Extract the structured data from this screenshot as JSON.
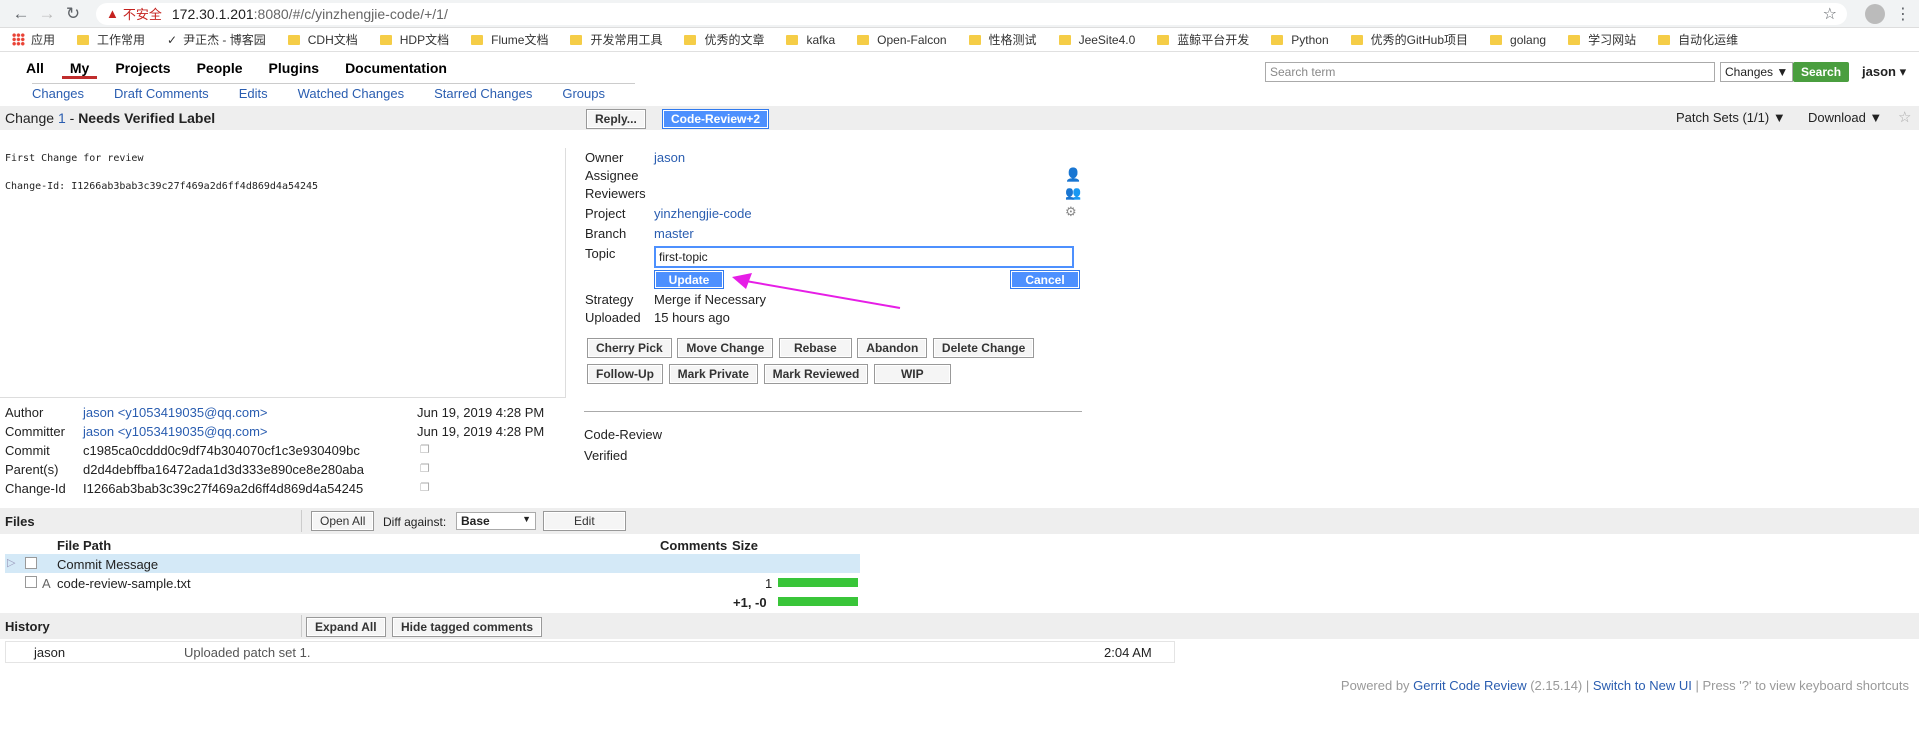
{
  "browser": {
    "url_host": "172.30.1.201",
    "url_rest": ":8080/#/c/yinzhengjie-code/+/1/",
    "insecure_label": "不安全",
    "bookmarks": [
      "应用",
      "工作常用",
      "尹正杰 - 博客园",
      "CDH文档",
      "HDP文档",
      "Flume文档",
      "开发常用工具",
      "优秀的文章",
      "kafka",
      "Open-Falcon",
      "性格测试",
      "JeeSite4.0",
      "蓝鲸平台开发",
      "Python",
      "优秀的GitHub项目",
      "golang",
      "学习网站",
      "自动化运维"
    ]
  },
  "nav": {
    "main": [
      "All",
      "My",
      "Projects",
      "People",
      "Plugins",
      "Documentation"
    ],
    "sub": [
      "Changes",
      "Draft Comments",
      "Edits",
      "Watched Changes",
      "Starred Changes",
      "Groups"
    ],
    "search_placeholder": "Search term",
    "search_scope": "Changes ▼",
    "search_button": "Search",
    "user": "jason ▾"
  },
  "change": {
    "prefix": "Change ",
    "number": "1",
    "dash": " - ",
    "status": "Needs Verified Label",
    "reply": "Reply...",
    "code_review": "Code-Review+2",
    "patch_sets": "Patch Sets (1/1) ▼",
    "download": "Download ▼",
    "commit_message": "First Change for review\n\nChange-Id: I1266ab3bab3c39c27f469a2d6ff4d869d4a54245"
  },
  "info": {
    "owner_label": "Owner",
    "owner": "jason",
    "assignee_label": "Assignee",
    "reviewers_label": "Reviewers",
    "project_label": "Project",
    "project": "yinzhengjie-code",
    "branch_label": "Branch",
    "branch": "master",
    "topic_label": "Topic",
    "topic_value": "first-topic",
    "update": "Update",
    "cancel": "Cancel",
    "strategy_label": "Strategy",
    "strategy": "Merge if Necessary",
    "uploaded_label": "Uploaded",
    "uploaded": "15 hours ago"
  },
  "actions": {
    "row1": [
      "Cherry Pick",
      "Move Change",
      "Rebase",
      "Abandon",
      "Delete Change"
    ],
    "row2": [
      "Follow-Up",
      "Mark Private",
      "Mark Reviewed",
      "WIP"
    ]
  },
  "meta": {
    "author_label": "Author",
    "author": "jason <y1053419035@qq.com>",
    "author_date": "Jun 19, 2019 4:28 PM",
    "committer_label": "Committer",
    "committer": "jason <y1053419035@qq.com>",
    "committer_date": "Jun 19, 2019 4:28 PM",
    "commit_label": "Commit",
    "commit": "c1985ca0cddd0c9df74b304070cf1c3e930409bc",
    "parent_label": "Parent(s)",
    "parent": "d2d4debffba16472ada1d3d333e890ce8e280aba",
    "changeid_label": "Change-Id",
    "changeid": "I1266ab3bab3c39c27f469a2d6ff4d869d4a54245"
  },
  "labels": [
    "Code-Review",
    "Verified"
  ],
  "files": {
    "title": "Files",
    "open_all": "Open All",
    "diff_against": "Diff against:",
    "base": "Base",
    "edit": "Edit",
    "col_path": "File Path",
    "col_comments": "Comments",
    "col_size": "Size",
    "commit_message": "Commit Message",
    "file_status": "A",
    "file_name": "code-review-sample.txt",
    "file_size": "1",
    "total": "+1, -0"
  },
  "history": {
    "title": "History",
    "expand_all": "Expand All",
    "hide_tagged": "Hide tagged comments",
    "author": "jason",
    "message": "Uploaded patch set 1.",
    "time": "2:04 AM"
  },
  "footer": {
    "powered_by": "Powered by ",
    "gerrit": "Gerrit Code Review",
    "version": " (2.15.14) | ",
    "switch": "Switch to New UI",
    "hint": " | Press '?' to view keyboard shortcuts"
  },
  "colors": {
    "accent": "#4d90fe",
    "link": "#2a5db0",
    "search_green": "#4a9e3f",
    "annotation": "#e61ee6"
  }
}
